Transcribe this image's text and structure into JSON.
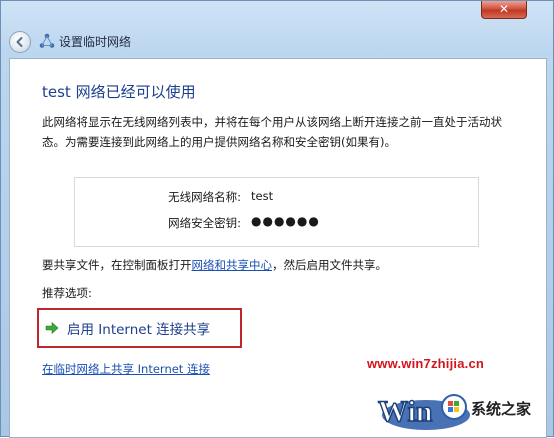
{
  "window": {
    "title": "设置临时网络",
    "close_label": "✕"
  },
  "main": {
    "heading": "test 网络已经可以使用",
    "description": "此网络将显示在无线网络列表中，并将在每个用户从该网络上断开连接之前一直处于活动状态。为需要连接到此网络上的用户提供网络名称和安全密钥(如果有)。",
    "network_info": {
      "name_label": "无线网络名称:",
      "name_value": "test",
      "key_label": "网络安全密钥:",
      "key_value": "●●●●●●"
    },
    "share_text_before": "要共享文件，在控制面板打开",
    "share_link": "网络和共享中心",
    "share_text_after": "，然后启用文件共享。",
    "recommended_label": "推荐选项:",
    "option_label": "启用 Internet 连接共享",
    "bottom_link": "在临时网络上共享 Internet 连接"
  },
  "watermark": {
    "url": "www.win7zhijia.cn",
    "brand": "系统之家"
  },
  "colors": {
    "heading": "#1d3f8f",
    "link": "#1a4fb4",
    "highlight_border": "#c0272d",
    "watermark_red": "#d4141b"
  }
}
